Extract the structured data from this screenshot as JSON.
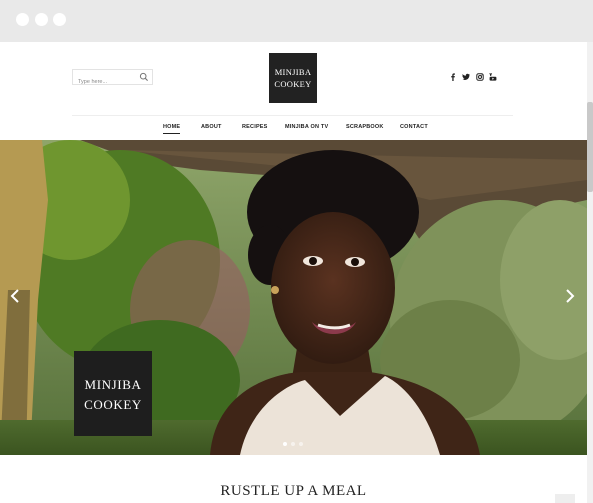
{
  "window": {
    "controls": [
      "close",
      "minimize",
      "maximize"
    ]
  },
  "search": {
    "placeholder": "Type here...",
    "icon": "search-icon"
  },
  "logo": {
    "line1": "MINJIBA",
    "line2": "COOKEY"
  },
  "social": {
    "icons": [
      "facebook-icon",
      "twitter-icon",
      "instagram-icon",
      "youtube-icon"
    ]
  },
  "nav": {
    "items": [
      {
        "label": "HOME",
        "active": true
      },
      {
        "label": "ABOUT"
      },
      {
        "label": "RECIPES"
      },
      {
        "label": "MINJIBA ON TV"
      },
      {
        "label": "SCRAPBOOK"
      },
      {
        "label": "CONTACT"
      }
    ]
  },
  "hero": {
    "logo_line1": "MINJIBA",
    "logo_line2": "COOKEY",
    "slides_count": 3,
    "active_slide": 1,
    "icons": [
      "chevron-left-icon",
      "chevron-right-icon"
    ]
  },
  "section": {
    "title": "RUSTLE UP A MEAL"
  },
  "colors": {
    "accent": "#222222",
    "chrome": "#e9e9e9",
    "logo_bg": "#222222"
  }
}
